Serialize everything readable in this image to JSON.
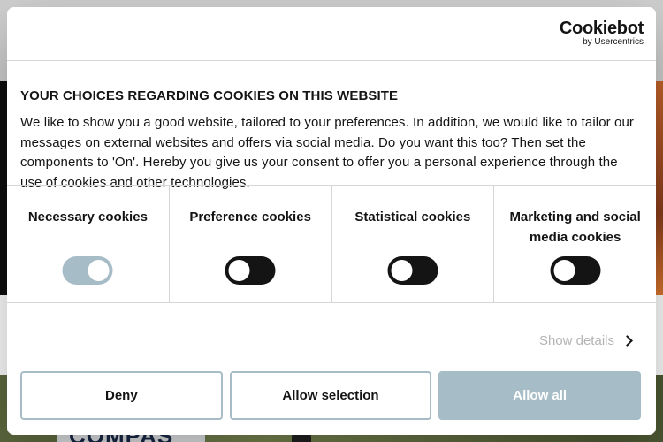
{
  "brand": {
    "name": "Cookiebot",
    "sub": "by Usercentrics"
  },
  "consent": {
    "title": "YOUR CHOICES REGARDING COOKIES ON THIS WEBSITE",
    "body": "We like to show you a good website, tailored to your preferences. In addition, we would like to tailor our messages on external websites and offers via social media. Do you want this too? Then set the components to 'On'. Hereby you give us your consent to offer you a personal experience through the use of cookies and other technologies."
  },
  "categories": [
    {
      "label": "Necessary cookies",
      "enabled": true,
      "locked": true
    },
    {
      "label": "Preference cookies",
      "enabled": false
    },
    {
      "label": "Statistical cookies",
      "enabled": false
    },
    {
      "label": "Marketing and social media cookies",
      "enabled": false
    }
  ],
  "details": {
    "label": "Show details",
    "icon": "chevron-right-icon"
  },
  "buttons": {
    "deny": "Deny",
    "allow_selection": "Allow selection",
    "allow_all": "Allow all"
  },
  "background": {
    "logo_text": "COMPAS"
  },
  "colors": {
    "accent": "#a6bcc6",
    "text": "#141414",
    "muted": "#b4b4b4",
    "divider": "#d6d6d6"
  }
}
